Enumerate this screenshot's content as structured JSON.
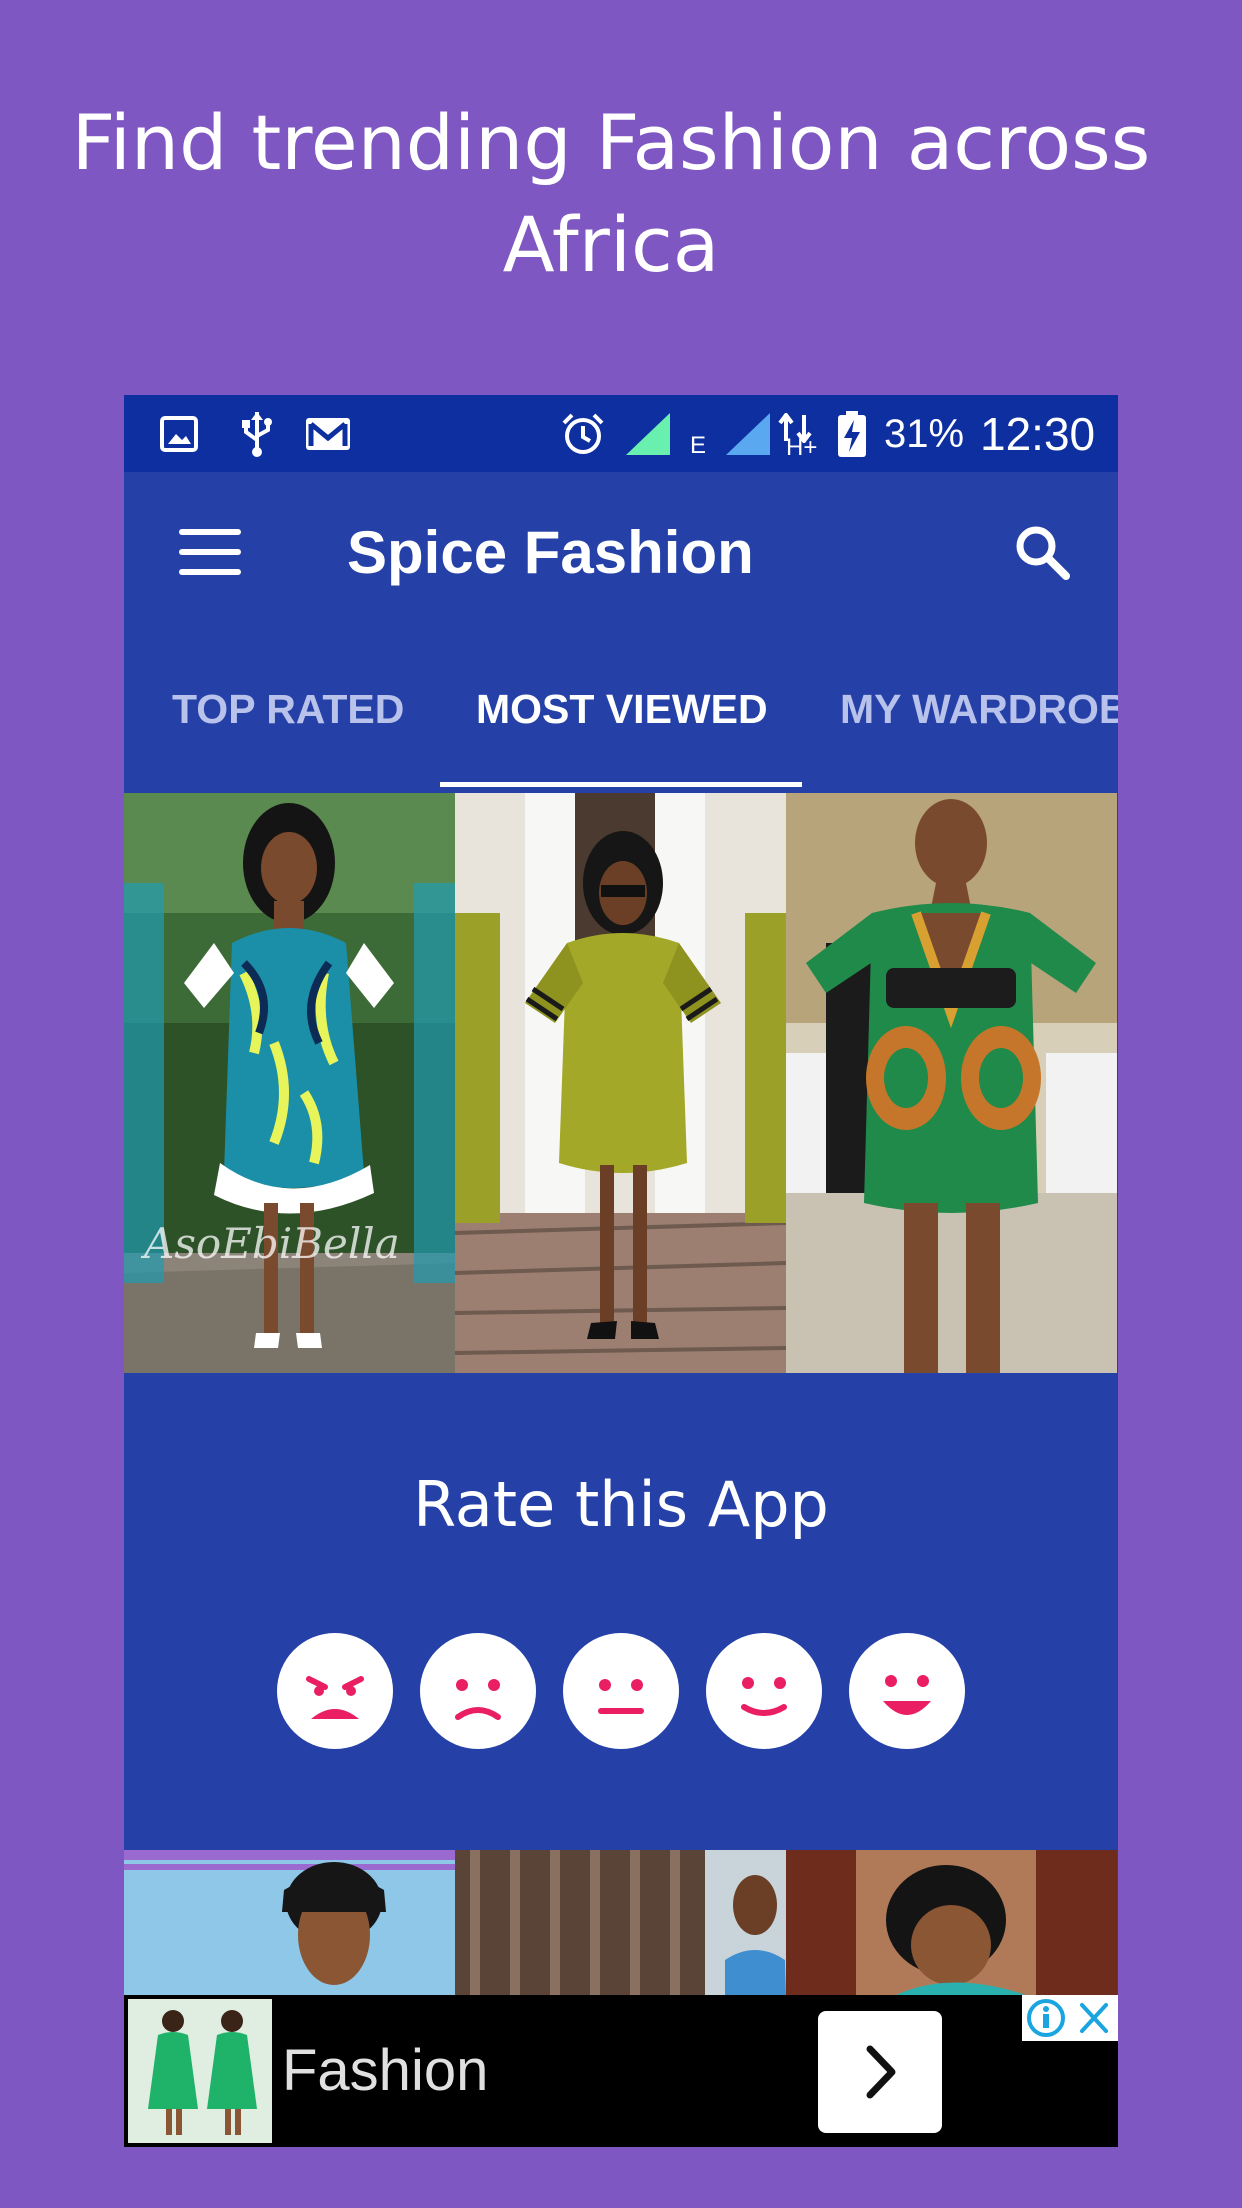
{
  "promo": {
    "title_line1": "Find trending Fashion across",
    "title_line2": "Africa"
  },
  "statusbar": {
    "icons": [
      "gallery-icon",
      "usb-icon",
      "gmail-icon",
      "alarm-icon",
      "signal-icon",
      "network-e-icon",
      "signal-icon",
      "network-hplus-icon",
      "battery-charging-icon"
    ],
    "network_e": "E",
    "network_hplus": "H+",
    "battery": "31%",
    "time": "12:30"
  },
  "appbar": {
    "title": "Spice Fashion",
    "menu_icon": "hamburger-menu-icon",
    "search_icon": "search-icon"
  },
  "tabs": [
    {
      "label": "TOP RATED",
      "active": false
    },
    {
      "label": "MOST VIEWED",
      "active": true
    },
    {
      "label": "MY WARDROB",
      "active": false
    }
  ],
  "photos_top": [
    {
      "watermark": "AsoEbiBella"
    },
    {
      "watermark": ""
    },
    {
      "watermark": ""
    }
  ],
  "rating": {
    "title": "Rate this App",
    "faces": [
      "very-sad-face-icon",
      "sad-face-icon",
      "neutral-face-icon",
      "happy-face-icon",
      "very-happy-face-icon"
    ]
  },
  "ad": {
    "text": "Fashion",
    "arrow_icon": "chevron-right-icon",
    "choices_icon": "ad-choices-icon",
    "close_icon": "close-icon"
  },
  "colors": {
    "background": "#7e57c2",
    "app_primary": "#2541a8",
    "statusbar": "#0d2fa0",
    "face_accent": "#e91e63"
  }
}
